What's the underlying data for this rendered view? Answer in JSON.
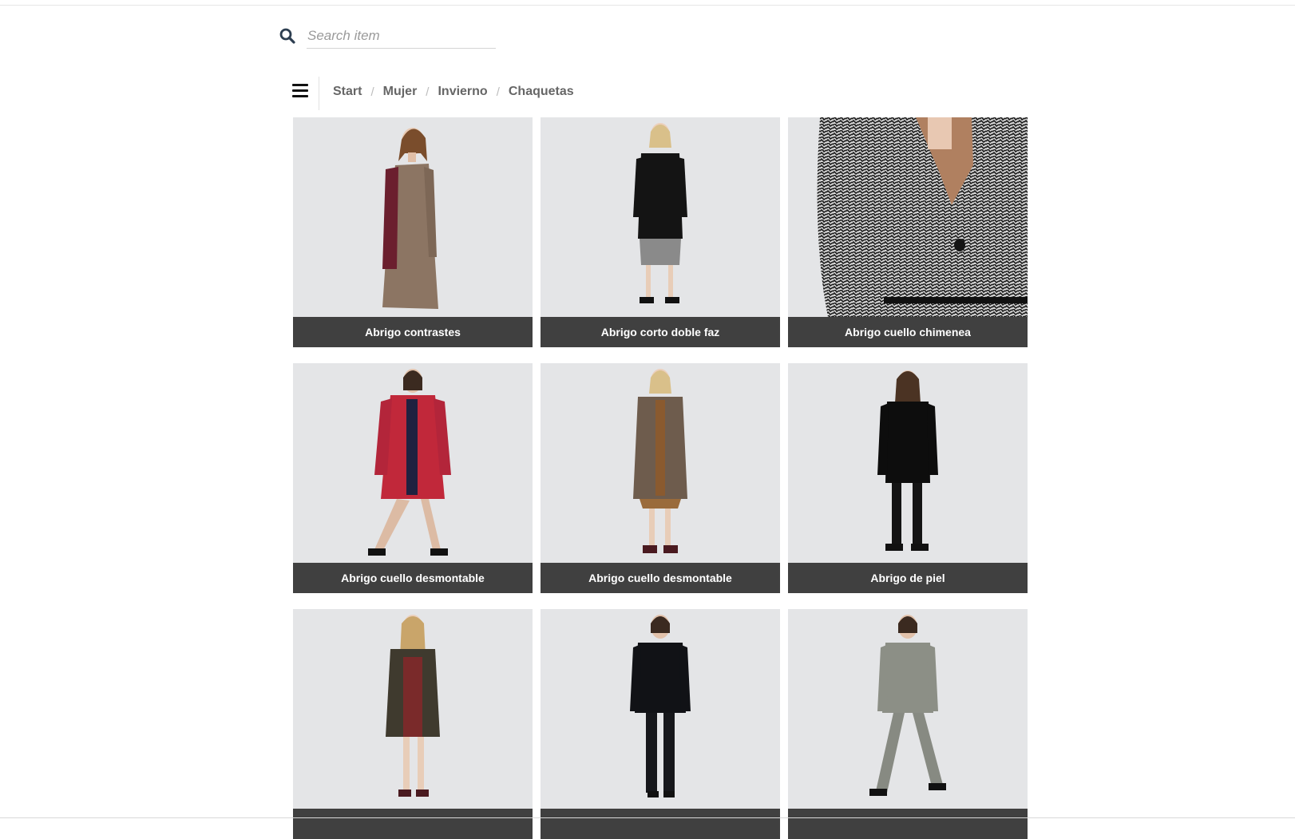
{
  "search": {
    "placeholder": "Search item",
    "value": ""
  },
  "breadcrumb": [
    "Start",
    "Mujer",
    "Invierno",
    "Chaquetas"
  ],
  "products": [
    {
      "title": "Abrigo contrastes"
    },
    {
      "title": "Abrigo corto doble faz"
    },
    {
      "title": "Abrigo cuello chimenea"
    },
    {
      "title": "Abrigo cuello desmontable"
    },
    {
      "title": "Abrigo cuello desmontable"
    },
    {
      "title": "Abrigo de piel"
    },
    {
      "title": ""
    },
    {
      "title": ""
    },
    {
      "title": ""
    }
  ],
  "colors": {
    "caption_bg": "#404040",
    "image_bg": "#e4e5e7",
    "search_icon": "#2d3e50"
  }
}
